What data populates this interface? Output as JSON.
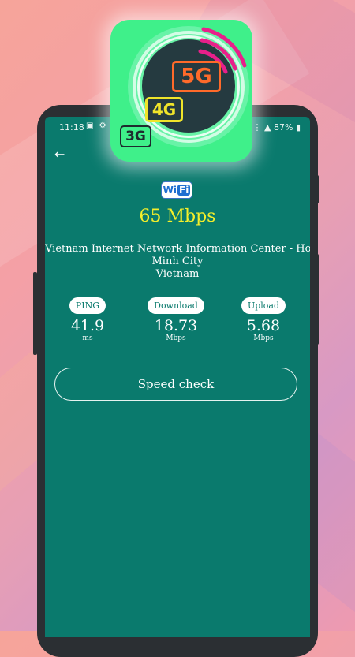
{
  "status_bar": {
    "time": "11:18",
    "left_icons": "▣ ⚙ ·",
    "right": "⋮ ▲ 87% ▮"
  },
  "app_icon": {
    "labels": [
      "5G",
      "4G",
      "3G"
    ],
    "colors": {
      "background": "#3ff08a",
      "label_5g": "#ff6a2a",
      "label_4g": "#f0e42a",
      "arc": "#e8208a"
    }
  },
  "screen": {
    "back_icon": "←",
    "network_badge": {
      "prefix": "Wi",
      "suffix": "Fi"
    },
    "speed": "65 Mbps",
    "server": {
      "line1": "Vietnam Internet Network Information Center - Ho Chi",
      "line2": "Minh City",
      "line3": "Vietnam"
    },
    "stats": [
      {
        "label": "PING",
        "value": "41.9",
        "unit": "ms"
      },
      {
        "label": "Download",
        "value": "18.73",
        "unit": "Mbps"
      },
      {
        "label": "Upload",
        "value": "5.68",
        "unit": "Mbps"
      }
    ],
    "action_button": "Speed check"
  },
  "colors": {
    "screen_bg": "#0a7a6d",
    "speed_text": "#f5ef2a",
    "frame": "#2b2f33"
  }
}
